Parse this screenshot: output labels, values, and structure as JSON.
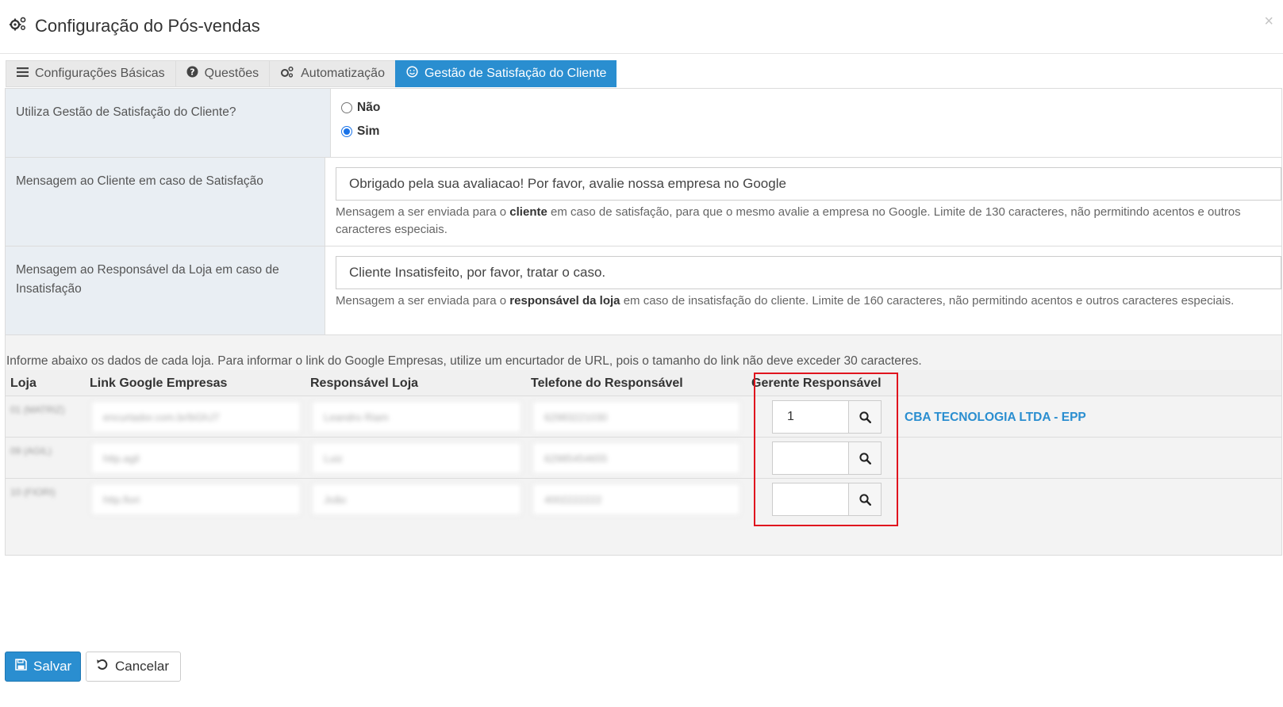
{
  "header": {
    "title": "Configuração do Pós-vendas",
    "close": "×"
  },
  "tabs": [
    {
      "label": "Configurações Básicas",
      "icon": "list-icon"
    },
    {
      "label": "Questões",
      "icon": "question-circle-icon"
    },
    {
      "label": "Automatização",
      "icon": "gears-icon"
    },
    {
      "label": "Gestão de Satisfação do Cliente",
      "icon": "smile-icon",
      "active": true
    }
  ],
  "form": {
    "satisfaction": {
      "label": "Utiliza Gestão de Satisfação do Cliente?",
      "options": [
        {
          "label": "Não",
          "checked": false
        },
        {
          "label": "Sim",
          "checked": true
        }
      ]
    },
    "client_message": {
      "label": "Mensagem ao Cliente em caso de Satisfação",
      "value": "Obrigado pela sua avaliacao! Por favor, avalie nossa empresa no Google",
      "help_pre": "Mensagem a ser enviada para o ",
      "help_bold": "cliente",
      "help_post": " em caso de satisfação, para que o mesmo avalie a empresa no Google. Limite de 130 caracteres, não permitindo acentos e outros caracteres especiais."
    },
    "manager_message": {
      "label": "Mensagem ao Responsável da Loja em caso de Insatisfação",
      "value": "Cliente Insatisfeito, por favor, tratar o caso.",
      "help_pre": "Mensagem a ser enviada para o ",
      "help_bold": "responsável da loja",
      "help_post": " em caso de insatisfação do cliente. Limite de 160 caracteres, não permitindo acentos e outros caracteres especiais."
    }
  },
  "info_text": "Informe abaixo os dados de cada loja. Para informar o link do Google Empresas, utilize um encurtador de URL, pois o tamanho do link não deve exceder 30 caracteres.",
  "table": {
    "headers": [
      "Loja",
      "Link Google Empresas",
      "Responsável Loja",
      "Telefone do Responsável",
      "Gerente Responsável"
    ],
    "rows": [
      {
        "loja": "01 (MATRIZ)",
        "link": "encurtador.com.br/bGhJ7",
        "responsavel": "Leandro Riam",
        "telefone": "62983221030",
        "gerente": "1",
        "company": "CBA TECNOLOGIA LTDA - EPP"
      },
      {
        "loja": "09 (AGIL)",
        "link": "http.agil",
        "responsavel": "Luiz",
        "telefone": "62985454655",
        "gerente": "",
        "company": ""
      },
      {
        "loja": "10 (FIORI)",
        "link": "http.fiori",
        "responsavel": "João",
        "telefone": "4002222222",
        "gerente": "",
        "company": ""
      }
    ]
  },
  "buttons": {
    "save": "Salvar",
    "cancel": "Cancelar"
  },
  "colors": {
    "primary": "#2a8ed0",
    "highlight": "#e0141e"
  }
}
